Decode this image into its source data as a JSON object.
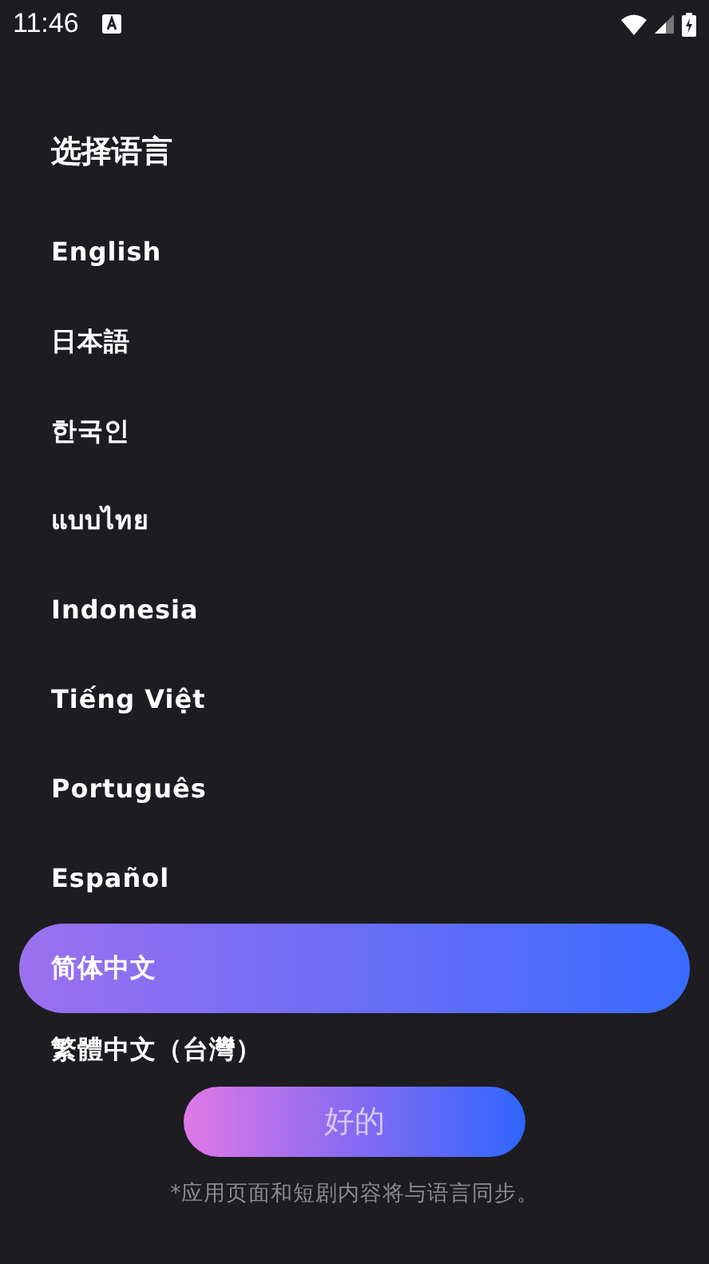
{
  "status_bar": {
    "time": "11:46"
  },
  "title": "选择语言",
  "languages": [
    {
      "label": "English",
      "selected": false
    },
    {
      "label": "日本語",
      "selected": false
    },
    {
      "label": "한국인",
      "selected": false
    },
    {
      "label": "แบบไทย",
      "selected": false
    },
    {
      "label": "Indonesia",
      "selected": false
    },
    {
      "label": "Tiếng Việt",
      "selected": false
    },
    {
      "label": "Português",
      "selected": false
    },
    {
      "label": "Español",
      "selected": false
    },
    {
      "label": "简体中文",
      "selected": true
    },
    {
      "label": "繁體中文（台灣）",
      "selected": false
    }
  ],
  "confirm_button": "好的",
  "note": "*应用页面和短剧内容将与语言同步。"
}
